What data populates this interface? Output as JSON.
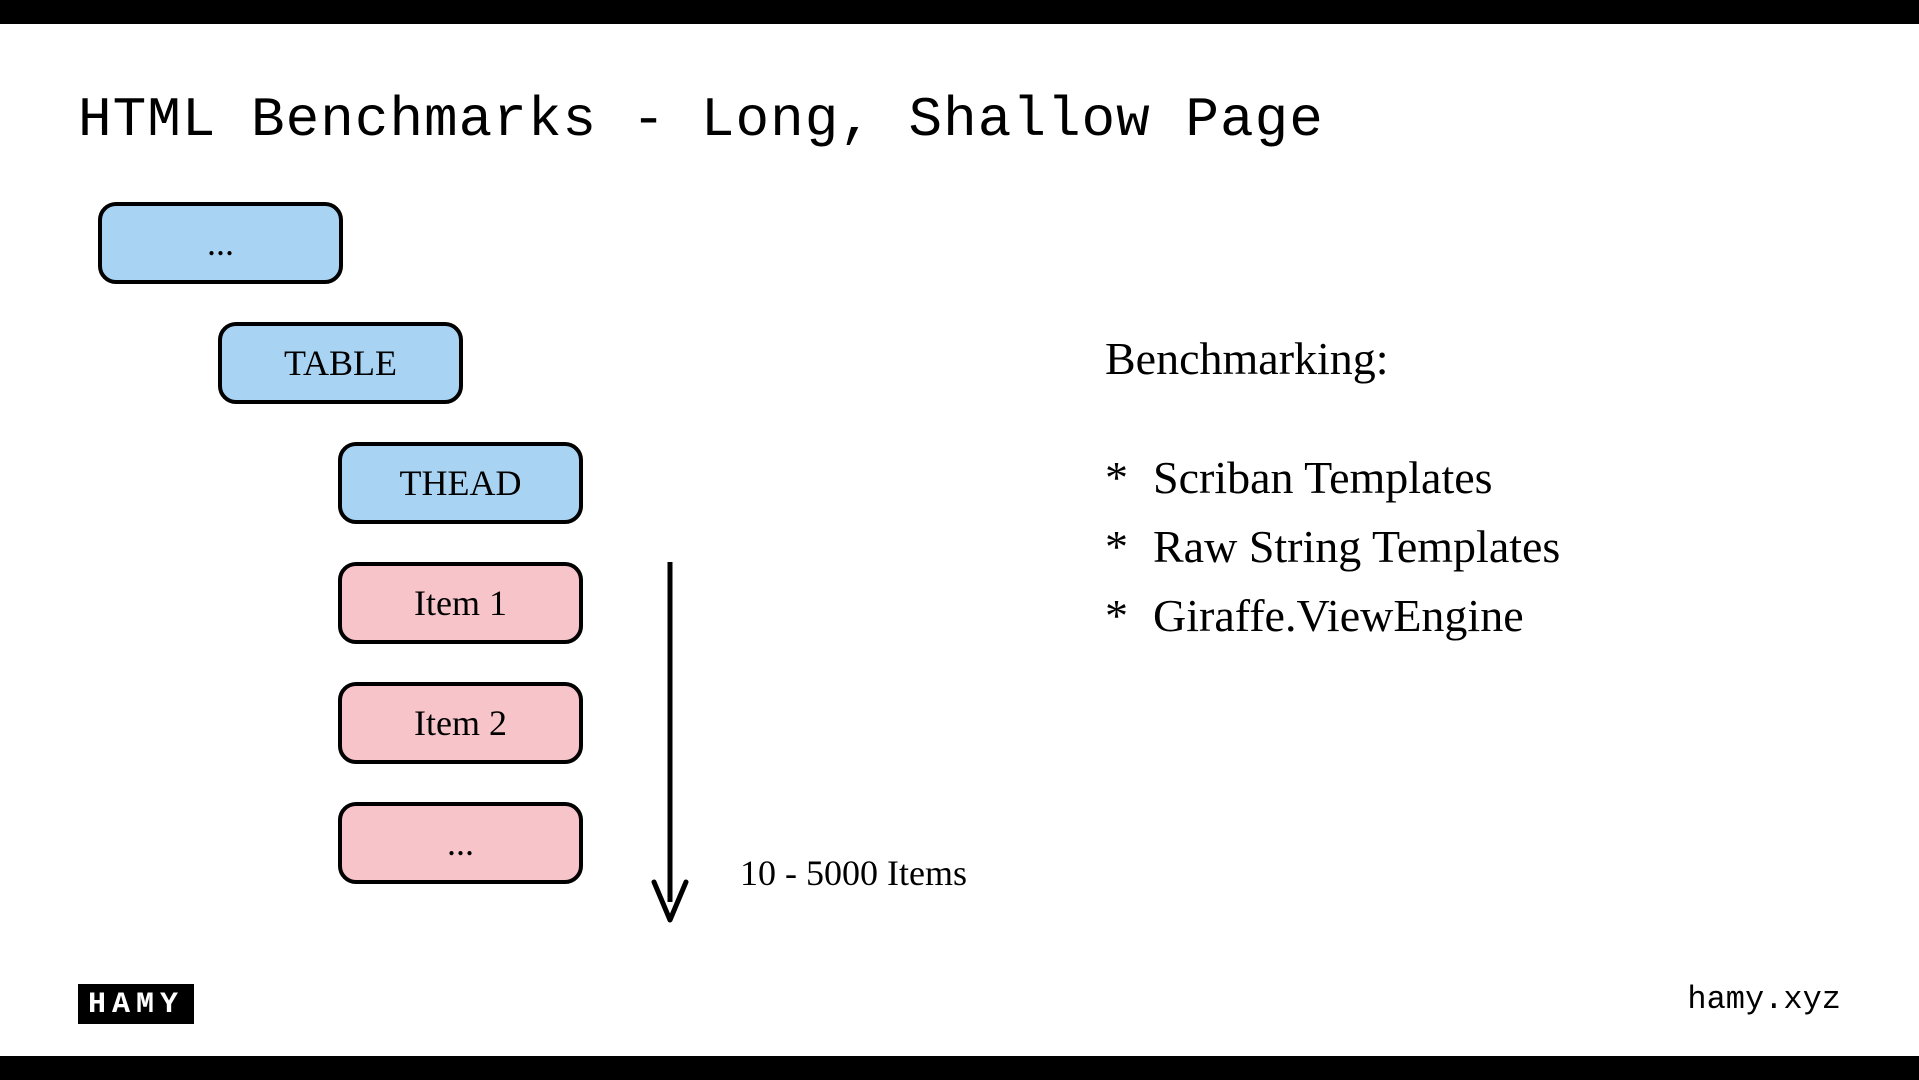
{
  "title": "HTML Benchmarks - Long, Shallow Page",
  "nodes": {
    "root": "...",
    "table": "TABLE",
    "thead": "THEAD",
    "item1": "Item 1",
    "item2": "Item 2",
    "more": "..."
  },
  "arrow_label": "10 - 5000 Items",
  "bench_heading": "Benchmarking:",
  "bench_items": {
    "a": "Scriban Templates",
    "b": "Raw String Templates",
    "c": "Giraffe.ViewEngine"
  },
  "logo_text": "HAMY",
  "url": "hamy.xyz"
}
